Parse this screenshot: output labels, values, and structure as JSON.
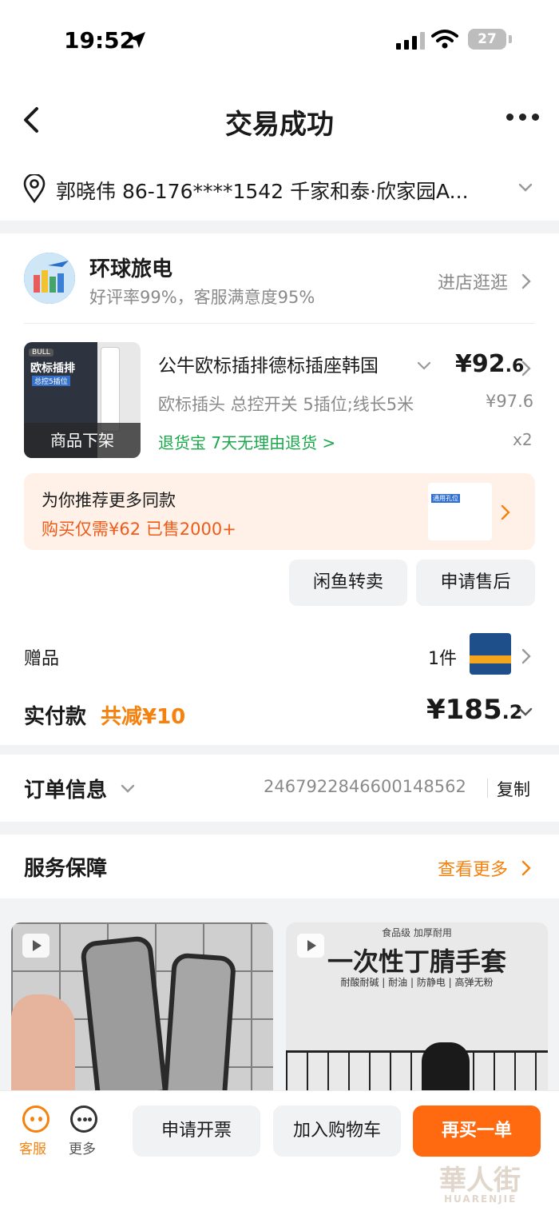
{
  "status_bar": {
    "time": "19:52",
    "battery": "27"
  },
  "nav": {
    "title": "交易成功"
  },
  "address": {
    "text": "郭晓伟  86-176****1542  千家和泰·欣家园A..."
  },
  "shop": {
    "name": "环球旅电",
    "rating": "好评率99%，客服满意度95%",
    "enter_label": "进店逛逛"
  },
  "product": {
    "image_tag": "BULL",
    "image_title": "欧标插排",
    "image_subtitle": "总控5插位",
    "offshelf_label": "商品下架",
    "name": "公牛欧标插排德标插座韩国",
    "price_main": "¥92",
    "price_decimal": ".6",
    "spec": "欧标插头 总控开关 5插位;线长5米",
    "original_price": "¥97.6",
    "return_text": "退货宝  7天无理由退货 >",
    "quantity": "x2"
  },
  "recommend": {
    "title": "为你推荐更多同款",
    "price_text": "购买仅需¥62 已售2000+",
    "thumb_label": "通用孔位"
  },
  "actions": {
    "resell": "闲鱼转卖",
    "after_sale": "申请售后"
  },
  "gift": {
    "label": "赠品",
    "count": "1件"
  },
  "payment": {
    "label": "实付款",
    "discount": "共减¥10",
    "amount_main": "¥185",
    "amount_decimal": ".2"
  },
  "order": {
    "title": "订单信息",
    "number": "2467922846600148562",
    "copy_label": "复制"
  },
  "service": {
    "title": "服务保障",
    "more_label": "查看更多"
  },
  "feed": {
    "item2_small": "食品级 加厚耐用",
    "item2_title": "一次性丁腈手套",
    "item2_tags": "耐酸耐碱 | 耐油 | 防静电 | 高弹无粉"
  },
  "bottom_bar": {
    "customer_service": "客服",
    "more": "更多",
    "invoice": "申请开票",
    "add_cart": "加入购物车",
    "rebuy": "再买一单"
  },
  "watermark": {
    "mark": "華人街",
    "sub": "HUARENJIE"
  },
  "colors": {
    "accent_orange": "#ff6a10",
    "discount_orange": "#f5820f",
    "green": "#1aa74b",
    "grey_text": "#8a8a8a"
  }
}
